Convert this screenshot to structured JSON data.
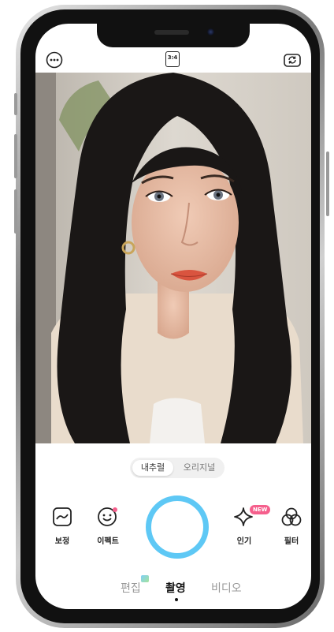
{
  "top_bar": {
    "more_icon": "ellipsis-circle-icon",
    "ratio_label": "3:4",
    "flip_icon": "camera-flip-icon"
  },
  "photo": {
    "subject": "selfie-preview"
  },
  "mode_toggle": {
    "options": [
      "내추럴",
      "오리지널"
    ],
    "selected": "내추럴"
  },
  "tools": {
    "left": [
      {
        "label": "보정",
        "icon": "retouch-icon"
      },
      {
        "label": "이펙트",
        "icon": "smiley-effect-icon"
      }
    ],
    "right": [
      {
        "label": "인기",
        "icon": "sparkle-icon",
        "badge": "NEW"
      },
      {
        "label": "필터",
        "icon": "filter-circles-icon"
      }
    ]
  },
  "bottom_modes": {
    "items": [
      "편집",
      "촬영",
      "비디오"
    ],
    "active": "촬영"
  },
  "colors": {
    "accent": "#5ec8f5",
    "badge": "#f55f8c"
  }
}
